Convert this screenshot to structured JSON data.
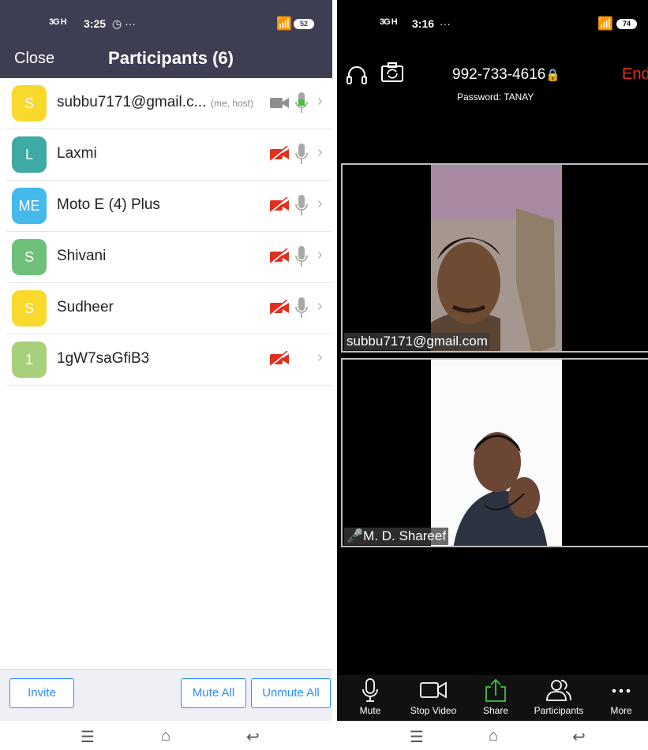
{
  "left": {
    "status": {
      "signal": "3G H",
      "time": "3:25",
      "extra": "◷ ···",
      "battery": "52"
    },
    "nav": {
      "close_label": "Close",
      "title": "Participants (6)"
    },
    "participants": [
      {
        "initial": "S",
        "name": "subbu7171@gmail.c...",
        "tag": "(me, host)",
        "color": "#f9d92b",
        "video": "on",
        "mic": "active"
      },
      {
        "initial": "L",
        "name": "Laxmi",
        "tag": "",
        "color": "#3fa9a3",
        "video": "off",
        "mic": "on"
      },
      {
        "initial": "ME",
        "name": "Moto E (4) Plus",
        "tag": "",
        "color": "#43b9ec",
        "video": "off",
        "mic": "on"
      },
      {
        "initial": "S",
        "name": "Shivani",
        "tag": "",
        "color": "#6ec07a",
        "video": "off",
        "mic": "on"
      },
      {
        "initial": "S",
        "name": "Sudheer",
        "tag": "",
        "color": "#f9d92b",
        "video": "off",
        "mic": "on"
      },
      {
        "initial": "1",
        "name": "1gW7saGfiB3",
        "tag": "",
        "color": "#a8d07c",
        "video": "off",
        "mic": "none"
      }
    ],
    "footer": {
      "invite_label": "Invite",
      "mute_all_label": "Mute All",
      "unmute_all_label": "Unmute All"
    }
  },
  "right": {
    "status": {
      "signal": "3G H",
      "time": "3:16",
      "extra": "···",
      "battery": "74"
    },
    "meeting": {
      "id": "992-733-4616",
      "password": "Password: TANAY",
      "end_label": "End"
    },
    "videos": [
      {
        "name": "subbu7171@gmail.com",
        "muted": false
      },
      {
        "name": "M. D. Shareef",
        "muted": true
      }
    ],
    "toolbar": {
      "mute_label": "Mute",
      "stop_video_label": "Stop Video",
      "share_label": "Share",
      "participants_label": "Participants",
      "more_label": "More"
    }
  },
  "colors": {
    "accent": "#2d8cff",
    "header": "#3d3e52",
    "end": "#e0301e",
    "video_off": "#e0301e",
    "mic_active": "#3ec43b"
  },
  "icons": {
    "nav_menu": "☰",
    "nav_home": "⌂",
    "nav_back": "↩"
  }
}
